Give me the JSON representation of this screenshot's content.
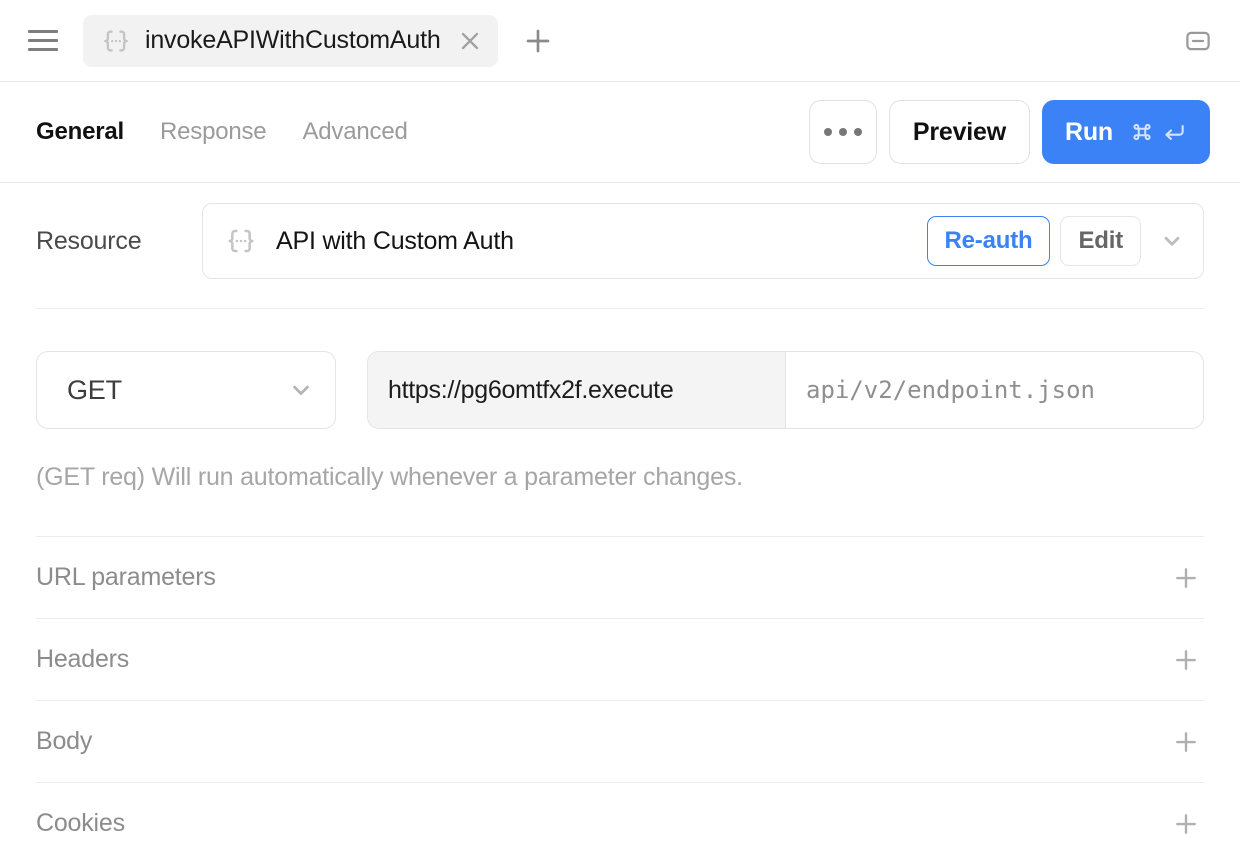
{
  "titlebar": {
    "menu_icon": "hamburger-menu-icon",
    "tab": {
      "icon": "curly-braces-icon",
      "label": "invokeAPIWithCustomAuth",
      "close_icon": "close-icon"
    },
    "new_tab_icon": "plus-icon",
    "minimize_icon": "minimize-icon"
  },
  "toolbar": {
    "tabs": [
      {
        "label": "General",
        "active": true
      },
      {
        "label": "Response",
        "active": false
      },
      {
        "label": "Advanced",
        "active": false
      }
    ],
    "more_label": "•••",
    "preview_label": "Preview",
    "run_label": "Run",
    "run_shortcut_cmd": "⌘",
    "run_shortcut_return": "↵",
    "accent_color": "#3b82f6"
  },
  "resource": {
    "label": "Resource",
    "icon": "curly-braces-icon",
    "name": "API with Custom Auth",
    "reauth_label": "Re-auth",
    "edit_label": "Edit",
    "chevron_icon": "chevron-down-icon"
  },
  "request": {
    "method": "GET",
    "method_chevron_icon": "chevron-down-icon",
    "url_prefix": "https://pg6omtfx2f.execute",
    "path_placeholder": "api/v2/endpoint.json",
    "hint": "(GET req) Will run automatically whenever a parameter changes."
  },
  "sections": [
    {
      "label": "URL parameters",
      "add_icon": "plus-icon"
    },
    {
      "label": "Headers",
      "add_icon": "plus-icon"
    },
    {
      "label": "Body",
      "add_icon": "plus-icon"
    },
    {
      "label": "Cookies",
      "add_icon": "plus-icon"
    }
  ]
}
